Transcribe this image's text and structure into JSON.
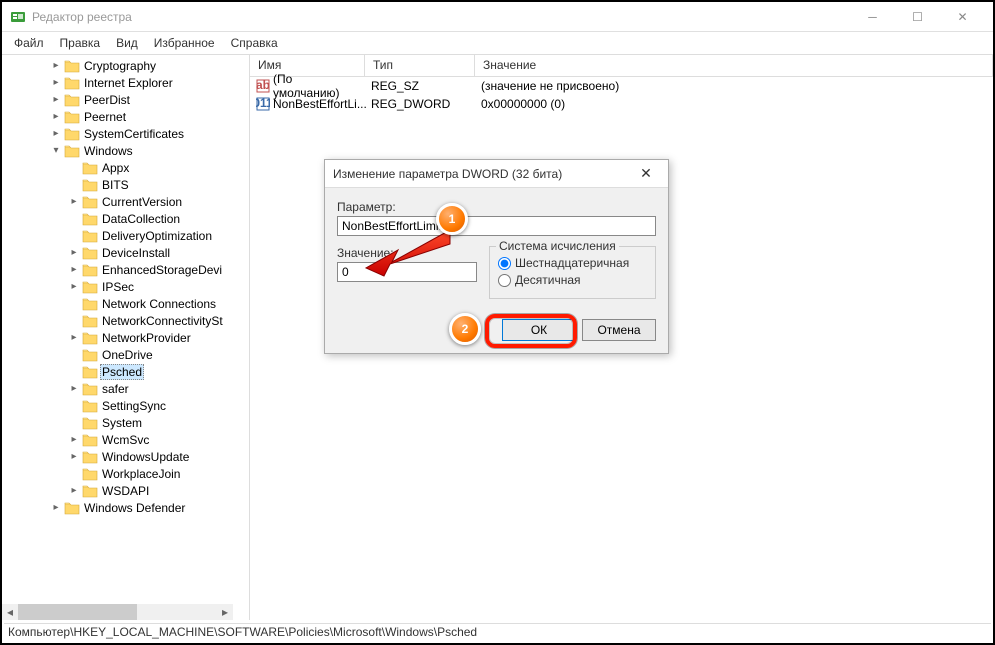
{
  "window": {
    "title": "Редактор реестра"
  },
  "menu": {
    "file": "Файл",
    "edit": "Правка",
    "view": "Вид",
    "favorites": "Избранное",
    "help": "Справка"
  },
  "tree": [
    {
      "label": "Cryptography",
      "depth": 2,
      "exp": "▸"
    },
    {
      "label": "Internet Explorer",
      "depth": 2,
      "exp": "▸"
    },
    {
      "label": "PeerDist",
      "depth": 2,
      "exp": "▸"
    },
    {
      "label": "Peernet",
      "depth": 2,
      "exp": "▸"
    },
    {
      "label": "SystemCertificates",
      "depth": 2,
      "exp": "▸"
    },
    {
      "label": "Windows",
      "depth": 2,
      "exp": "▾"
    },
    {
      "label": "Appx",
      "depth": 3,
      "exp": ""
    },
    {
      "label": "BITS",
      "depth": 3,
      "exp": ""
    },
    {
      "label": "CurrentVersion",
      "depth": 3,
      "exp": "▸"
    },
    {
      "label": "DataCollection",
      "depth": 3,
      "exp": ""
    },
    {
      "label": "DeliveryOptimization",
      "depth": 3,
      "exp": ""
    },
    {
      "label": "DeviceInstall",
      "depth": 3,
      "exp": "▸"
    },
    {
      "label": "EnhancedStorageDevi",
      "depth": 3,
      "exp": "▸"
    },
    {
      "label": "IPSec",
      "depth": 3,
      "exp": "▸"
    },
    {
      "label": "Network Connections",
      "depth": 3,
      "exp": ""
    },
    {
      "label": "NetworkConnectivitySt",
      "depth": 3,
      "exp": ""
    },
    {
      "label": "NetworkProvider",
      "depth": 3,
      "exp": "▸"
    },
    {
      "label": "OneDrive",
      "depth": 3,
      "exp": ""
    },
    {
      "label": "Psched",
      "depth": 3,
      "exp": "",
      "selected": true
    },
    {
      "label": "safer",
      "depth": 3,
      "exp": "▸"
    },
    {
      "label": "SettingSync",
      "depth": 3,
      "exp": ""
    },
    {
      "label": "System",
      "depth": 3,
      "exp": ""
    },
    {
      "label": "WcmSvc",
      "depth": 3,
      "exp": "▸"
    },
    {
      "label": "WindowsUpdate",
      "depth": 3,
      "exp": "▸"
    },
    {
      "label": "WorkplaceJoin",
      "depth": 3,
      "exp": ""
    },
    {
      "label": "WSDAPI",
      "depth": 3,
      "exp": "▸"
    },
    {
      "label": "Windows Defender",
      "depth": 2,
      "exp": "▸"
    }
  ],
  "columns": {
    "name": "Имя",
    "type": "Тип",
    "value": "Значение"
  },
  "rows": [
    {
      "icon": "str",
      "name": "(По умолчанию)",
      "type": "REG_SZ",
      "value": "(значение не присвоено)"
    },
    {
      "icon": "bin",
      "name": "NonBestEffortLi...",
      "type": "REG_DWORD",
      "value": "0x00000000 (0)"
    }
  ],
  "dialog": {
    "title": "Изменение параметра DWORD (32 бита)",
    "param_label": "Параметр:",
    "param_value": "NonBestEffortLimit",
    "value_label": "Значение:",
    "value_input": "0",
    "base_group": "Система исчисления",
    "radio_hex": "Шестнадцатеричная",
    "radio_dec": "Десятичная",
    "ok": "ОК",
    "cancel": "Отмена"
  },
  "statusbar": "Компьютер\\HKEY_LOCAL_MACHINE\\SOFTWARE\\Policies\\Microsoft\\Windows\\Psched",
  "badges": {
    "one": "1",
    "two": "2"
  }
}
